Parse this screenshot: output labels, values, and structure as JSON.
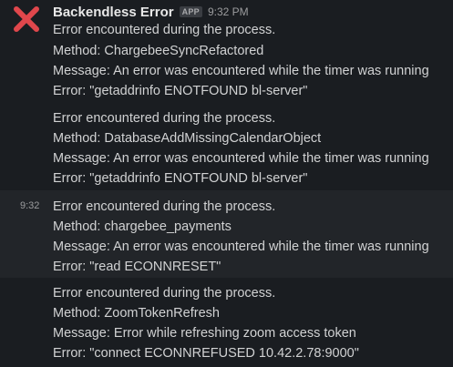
{
  "message": {
    "sender": "Backendless Error",
    "badge": "APP",
    "timestamp": "9:32 PM",
    "avatar_icon": "red-x-icon",
    "avatar_color": "#e0474c"
  },
  "blocks": [
    {
      "lines": [
        "Error encountered during the process.",
        "Method: ChargebeeSyncRefactored",
        "Message: An error was encountered while the timer was running",
        "Error: \"getaddrinfo ENOTFOUND bl-server\""
      ]
    },
    {
      "lines": [
        "Error encountered during the process.",
        "Method: DatabaseAddMissingCalendarObject",
        "Message: An error was encountered while the timer was running",
        "Error: \"getaddrinfo ENOTFOUND bl-server\""
      ]
    },
    {
      "hover_time": "9:32",
      "lines": [
        "Error encountered during the process.",
        "Method: chargebee_payments",
        "Message: An error was encountered while the timer was running",
        "Error: \"read ECONNRESET\""
      ]
    },
    {
      "lines": [
        "Error encountered during the process.",
        "Method: ZoomTokenRefresh",
        "Message: Error while refreshing zoom access token",
        "Error: \"connect ECONNREFUSED 10.42.2.78:9000\""
      ]
    }
  ]
}
